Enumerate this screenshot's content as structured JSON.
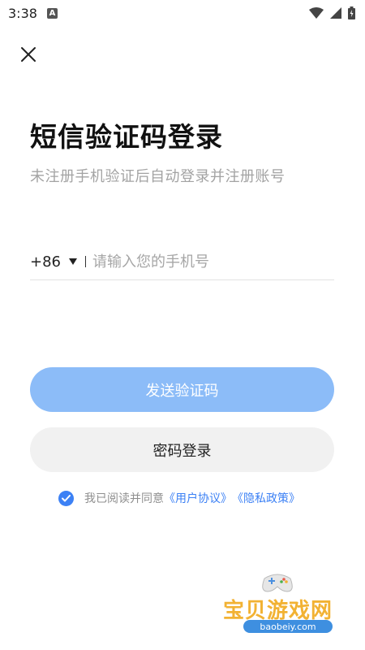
{
  "status_bar": {
    "time": "3:38",
    "notification_badge": "A",
    "icons": [
      "wifi-icon",
      "cellular-signal-icon",
      "battery-icon"
    ]
  },
  "header": {
    "close_icon": "close-icon"
  },
  "login": {
    "title": "短信验证码登录",
    "subtitle": "未注册手机验证后自动登录并注册账号",
    "country_code": "+86",
    "phone_placeholder": "请输入您的手机号",
    "phone_value": "",
    "send_code_button": "发送验证码",
    "password_login_button": "密码登录"
  },
  "agreement": {
    "checked": true,
    "prefix": "我已阅读并同意",
    "user_agreement": "《用户协议》",
    "privacy_policy": "《隐私政策》"
  },
  "watermark": {
    "name": "宝贝游戏网",
    "url": "baobeiy.com"
  },
  "colors": {
    "accent": "#3c81f5",
    "send_button_disabled": "#8cbcf8",
    "secondary_button": "#f1f1f1",
    "subtitle": "#a3a3a3"
  }
}
